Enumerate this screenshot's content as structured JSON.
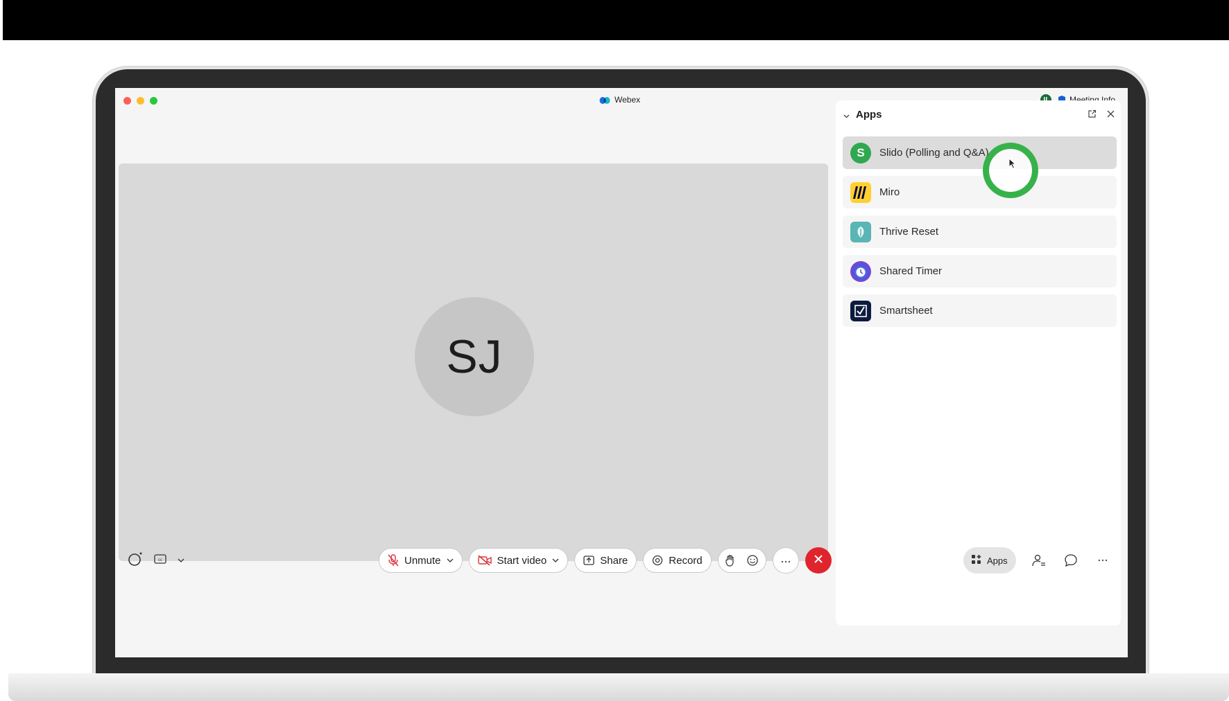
{
  "window": {
    "title": "Webex",
    "meeting_info_label": "Meeting Info"
  },
  "video": {
    "participant_initials": "SJ"
  },
  "apps_panel": {
    "title": "Apps",
    "items": [
      {
        "label": "Slido (Polling and Q&A)",
        "icon": "slido-icon",
        "icon_glyph": "S",
        "selected": true
      },
      {
        "label": "Miro",
        "icon": "miro-icon",
        "icon_glyph": "M",
        "selected": false
      },
      {
        "label": "Thrive Reset",
        "icon": "thrive-reset-icon",
        "selected": false
      },
      {
        "label": "Shared Timer",
        "icon": "shared-timer-icon",
        "selected": false
      },
      {
        "label": "Smartsheet",
        "icon": "smartsheet-icon",
        "icon_glyph": "☑",
        "selected": false
      }
    ]
  },
  "toolbar": {
    "unmute_label": "Unmute",
    "start_video_label": "Start video",
    "share_label": "Share",
    "record_label": "Record",
    "apps_label": "Apps"
  },
  "colors": {
    "end_call": "#e0242e",
    "slido_green": "#2fa84f",
    "miro_yellow": "#ffd02f",
    "click_ring": "#37b24a",
    "muted_red": "#d9343a"
  }
}
